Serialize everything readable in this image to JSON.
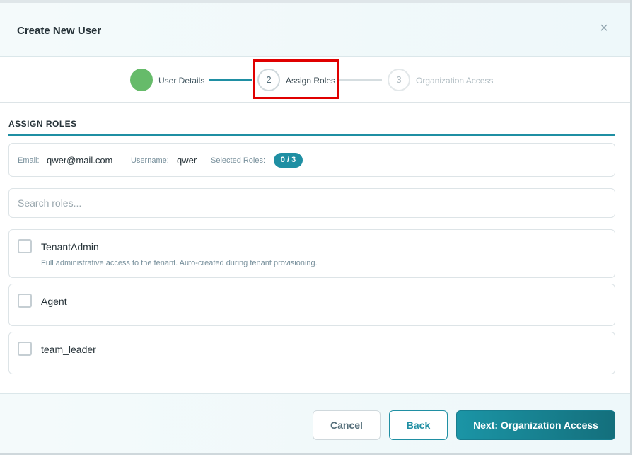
{
  "modal": {
    "title": "Create New User",
    "close_glyph": "×"
  },
  "stepper": {
    "steps": [
      {
        "number": "",
        "label": "User Details",
        "state": "completed"
      },
      {
        "number": "2",
        "label": "Assign Roles",
        "state": "active"
      },
      {
        "number": "3",
        "label": "Organization Access",
        "state": "upcoming"
      }
    ]
  },
  "section": {
    "title": "ASSIGN ROLES"
  },
  "summary": {
    "email_label": "Email:",
    "email_value": "qwer@mail.com",
    "username_label": "Username:",
    "username_value": "qwer",
    "selected_roles_label": "Selected Roles:",
    "selected_roles_value": "0 / 3"
  },
  "search": {
    "placeholder": "Search roles...",
    "value": ""
  },
  "roles": [
    {
      "name": "TenantAdmin",
      "description": "Full administrative access to the tenant. Auto-created during tenant provisioning.",
      "checked": false
    },
    {
      "name": "Agent",
      "description": "",
      "checked": false
    },
    {
      "name": "team_leader",
      "description": "",
      "checked": false
    }
  ],
  "footer": {
    "cancel_label": "Cancel",
    "back_label": "Back",
    "next_label": "Next: Organization Access"
  },
  "colors": {
    "accent": "#1f8fa3",
    "success": "#66bb6a",
    "highlight": "#e00000"
  }
}
